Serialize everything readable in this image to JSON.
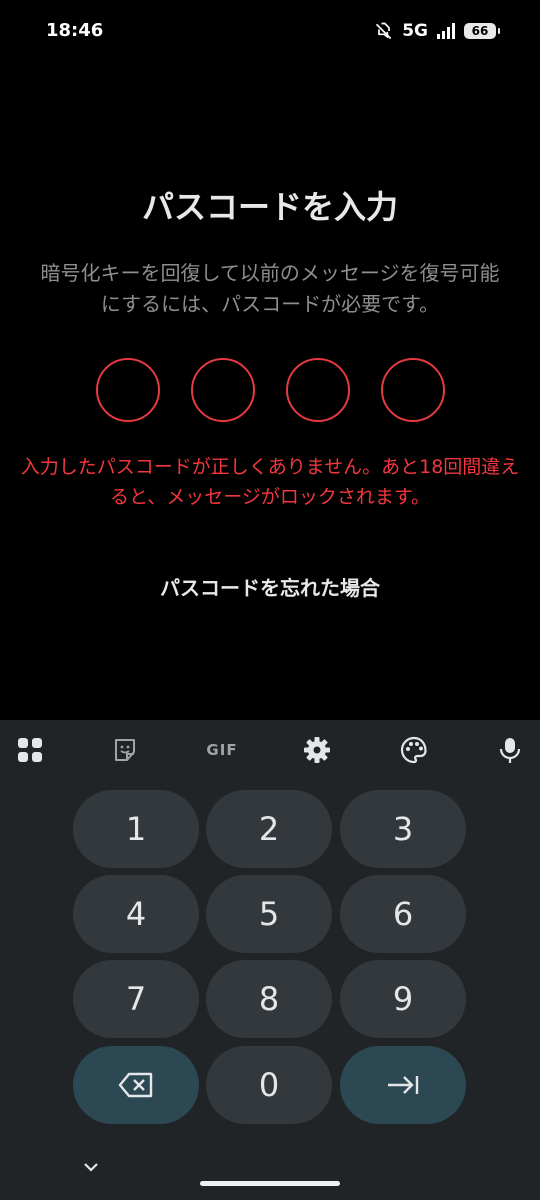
{
  "status_bar": {
    "time": "18:46",
    "network": "5G",
    "battery": "66"
  },
  "passcode": {
    "title": "パスコードを入力",
    "description": "暗号化キーを回復して以前のメッセージを復号可能にするには、パスコードが必要です。",
    "digits_entered": 0,
    "digit_count": 4,
    "error_message": "入力したパスコードが正しくありません。あと18回間違えると、メッセージがロックされます。",
    "forgot_link": "パスコードを忘れた場合"
  },
  "keyboard": {
    "toolbar": {
      "apps": "apps-grid-icon",
      "sticker": "sticker-icon",
      "gif": "GIF",
      "settings": "gear-icon",
      "theme": "palette-icon",
      "voice": "microphone-icon"
    },
    "keys": {
      "k1": "1",
      "k2": "2",
      "k3": "3",
      "k4": "4",
      "k5": "5",
      "k6": "6",
      "k7": "7",
      "k8": "8",
      "k9": "9",
      "k0": "0",
      "backspace": "backspace-icon",
      "next": "tab-next-icon"
    }
  },
  "colors": {
    "accent_error": "#f2373d",
    "keyboard_bg": "#202427",
    "key_bg": "#33383c",
    "special_key_bg": "#2c4852"
  }
}
